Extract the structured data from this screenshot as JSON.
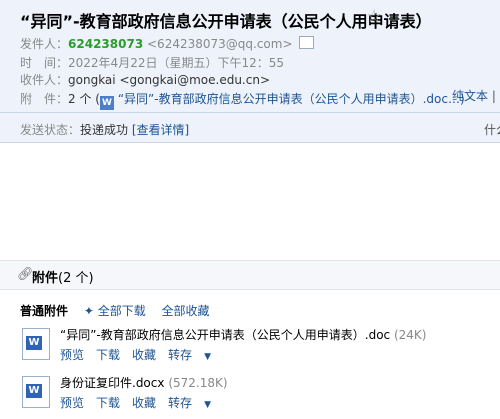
{
  "header": {
    "subject": "“异同”-教育部政府信息公开申请表（公民个人用申请表）",
    "star": "☆",
    "sender_label": "发件人：",
    "sender_name": "624238073",
    "sender_email": "<624238073@qq.com>",
    "time_label": "时　间：",
    "time_value": "2022年4月22日（星期五）下午12：55",
    "recipient_label": "收件人：",
    "recipient_value": "gongkai <gongkai@moe.edu.cn>",
    "attachment_label": "附　件：",
    "attachment_count": "2 个",
    "attachment_open_paren": "(",
    "attachment_preview": "“异同”-教育部政府信息公开申请表（公民个人用申请表）.doc…)",
    "plain_text": "纯文本",
    "plain_sep": "|",
    "status_label": "发送状态：",
    "status_value": "投递成功",
    "status_link": "[查看详情]",
    "status_right": "什么"
  },
  "attachments": {
    "title": "附件",
    "count": "(2 个)",
    "type_label": "普通附件",
    "download_all": "✦ 全部下载",
    "save_all": "全部收藏",
    "files": [
      {
        "name": "“异同”-教育部政府信息公开申请表（公民个人用申请表）.doc",
        "size": "(24K)",
        "actions": [
          "预览",
          "下载",
          "收藏",
          "转存"
        ]
      },
      {
        "name": "身份证复印件.docx",
        "size": "(572.18K)",
        "actions": [
          "预览",
          "下载",
          "收藏",
          "转存"
        ]
      }
    ]
  }
}
